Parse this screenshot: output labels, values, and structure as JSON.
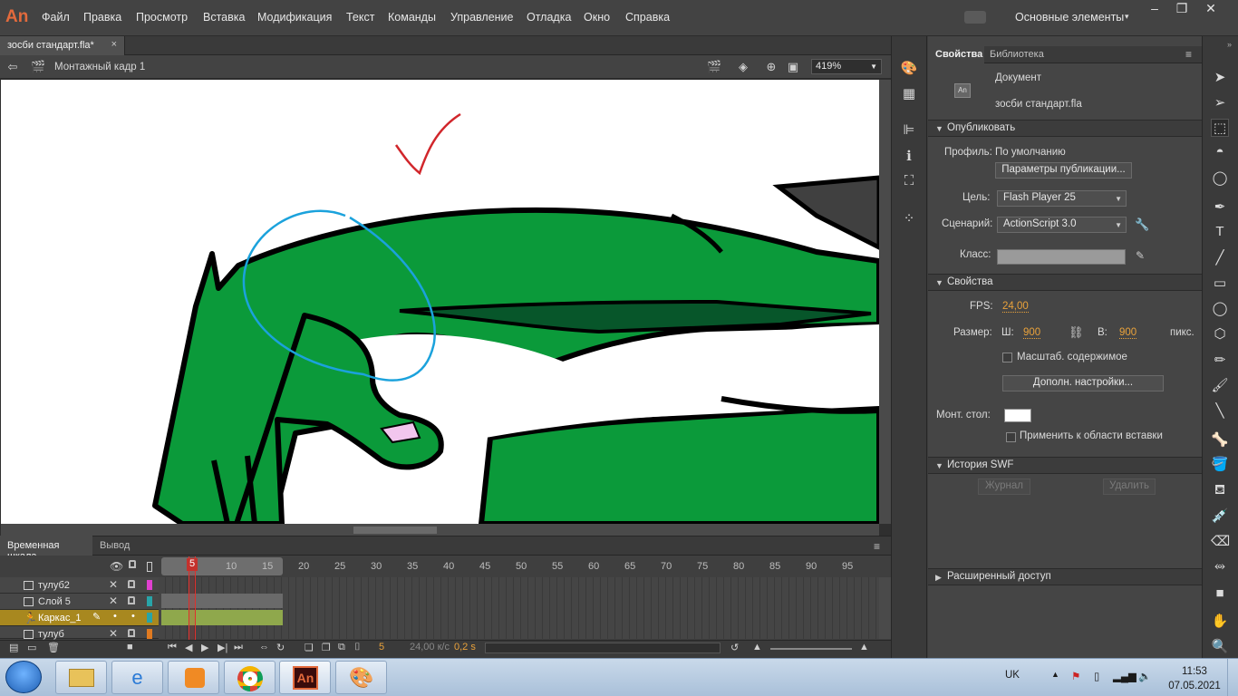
{
  "app": {
    "logo": "An",
    "workspace": "Основные элементы"
  },
  "menu": [
    "Файл",
    "Правка",
    "Просмотр",
    "Вставка",
    "Модификация",
    "Текст",
    "Команды",
    "Управление",
    "Отладка",
    "Окно",
    "Справка"
  ],
  "document_tab": {
    "name": "зосби стандарт.fla*",
    "close": "×"
  },
  "editbar": {
    "scene": "Монтажный кадр 1",
    "zoom": "419%"
  },
  "timeline": {
    "tabs": [
      "Временная шкала",
      "Вывод"
    ],
    "ruler": [
      "5",
      "10",
      "15",
      "20",
      "25",
      "30",
      "35",
      "40",
      "45",
      "50",
      "55",
      "60",
      "65",
      "70",
      "75",
      "80",
      "85",
      "90",
      "95"
    ],
    "current_frame_marker": "5",
    "layers": [
      {
        "name": "тулуб2",
        "color": "#e040d0",
        "selected": false
      },
      {
        "name": "Слой 5",
        "color": "#28a4a8",
        "selected": false
      },
      {
        "name": "Каркас_1",
        "color": "#28a4a8",
        "selected": true
      },
      {
        "name": "тулуб",
        "color": "#e07a20",
        "selected": false
      }
    ],
    "status": {
      "frame": "5",
      "fps": "24,00 к/с",
      "time": "0,2 s"
    }
  },
  "properties": {
    "tabs": [
      "Свойства",
      "Библиотека"
    ],
    "doc_type": "Документ",
    "doc_name": "зосби стандарт.fla",
    "publish": {
      "section": "Опубликовать",
      "profile_label": "Профиль:",
      "profile_value": "По умолчанию",
      "publish_settings_btn": "Параметры публикации...",
      "target_label": "Цель:",
      "target_value": "Flash Player 25",
      "script_label": "Сценарий:",
      "script_value": "ActionScript 3.0",
      "class_label": "Класс:"
    },
    "props": {
      "section": "Свойства",
      "fps_label": "FPS:",
      "fps_value": "24,00",
      "size_label": "Размер:",
      "w_label": "Ш:",
      "w_value": "900",
      "h_label": "В:",
      "h_value": "900",
      "units": "пикс.",
      "scale_content": "Масштаб. содержимое",
      "advanced_btn": "Дополн. настройки...",
      "stage_label": "Монт. стол:",
      "stage_color": "#ffffff",
      "apply_paste": "Применить к области вставки"
    },
    "swf_history": {
      "section": "История SWF",
      "log_btn": "Журнал",
      "delete_btn": "Удалить"
    },
    "accessibility": {
      "section": "Расширенный доступ"
    }
  },
  "colors": {
    "accent": "#e9a23b",
    "playhead": "#e0302c",
    "selected_layer": "#a8881f",
    "character_green": "#0b9a3a"
  },
  "taskbar": {
    "lang": "UK",
    "time": "11:53",
    "date": "07.05.2021"
  }
}
